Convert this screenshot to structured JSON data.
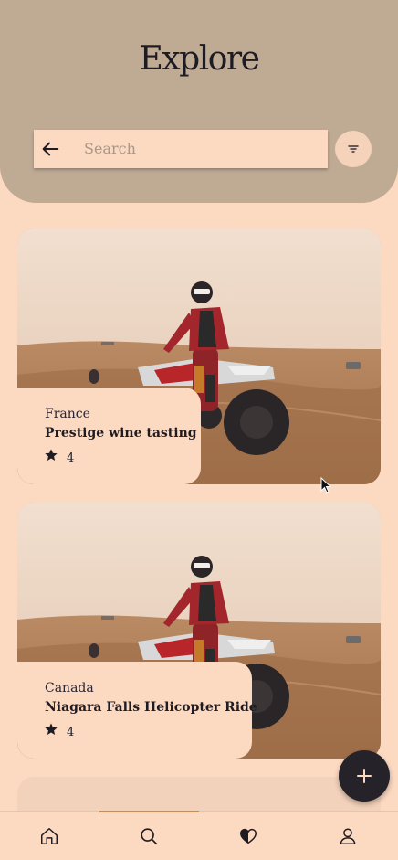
{
  "header": {
    "title": "Explore"
  },
  "search": {
    "placeholder": "Search"
  },
  "colors": {
    "header_bg": "#bfaa94",
    "page_bg": "#fcd9c1",
    "fab_bg": "#25222a",
    "active_indicator": "#d18a4d"
  },
  "experiences": [
    {
      "country": "France",
      "name": "Prestige wine tasting",
      "rating": "4"
    },
    {
      "country": "Canada",
      "name": "Niagara Falls Helicopter Ride",
      "rating": "4"
    }
  ],
  "fab": {
    "icon": "plus-icon"
  },
  "nav": {
    "active": "search",
    "items": [
      {
        "icon": "home-icon"
      },
      {
        "icon": "search-icon"
      },
      {
        "icon": "heart-icon"
      },
      {
        "icon": "user-icon"
      }
    ]
  }
}
